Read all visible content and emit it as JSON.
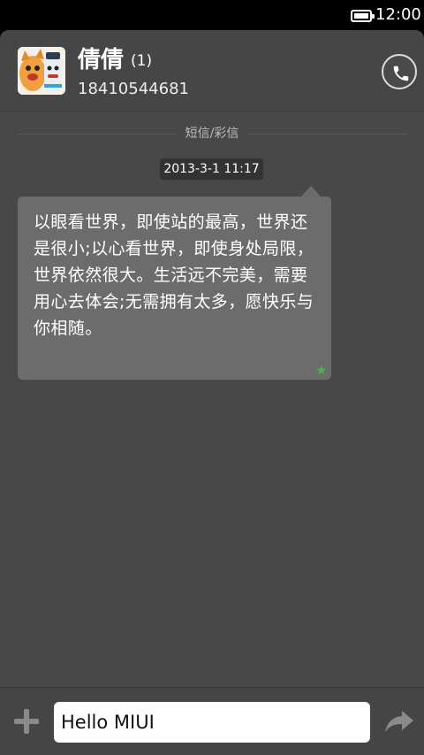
{
  "status_bar": {
    "time": "12:00"
  },
  "header": {
    "contact_name": "倩倩",
    "count": "(1)",
    "phone": "18410544681"
  },
  "section_label": "短信/彩信",
  "message": {
    "timestamp": "2013-3-1 11:17",
    "text": "以眼看世界，即使站的最高，世界还是很小;以心看世界，即使身处局限，世界依然很大。生活远不完美，需要用心去体会;无需拥有太多，愿快乐与你相随。",
    "star": "★"
  },
  "composer": {
    "value": "Hello MIUI"
  },
  "colors": {
    "background": "#484848",
    "bubble": "#6c6c6c",
    "star": "#3fbf4a"
  }
}
